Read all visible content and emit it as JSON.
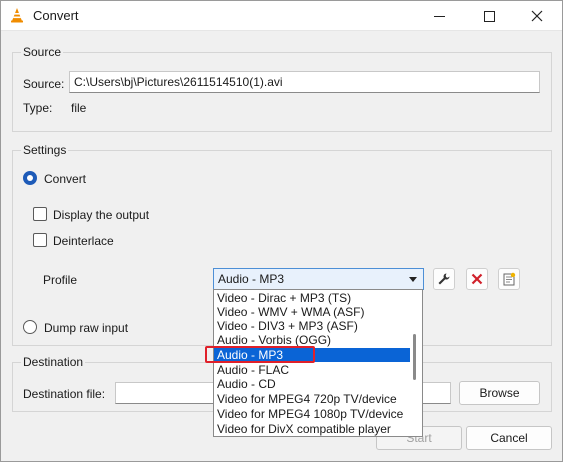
{
  "window": {
    "title": "Convert",
    "controls": {
      "minimize": "—",
      "maximize": "☐",
      "close": "✕"
    }
  },
  "source": {
    "group_label": "Source",
    "source_label": "Source:",
    "source_value": "C:\\Users\\bj\\Pictures\\2611514510(1).avi",
    "type_label": "Type:",
    "type_value": "file"
  },
  "settings": {
    "group_label": "Settings",
    "convert_label": "Convert",
    "convert_checked": true,
    "display_output_label": "Display the output",
    "deinterlace_label": "Deinterlace",
    "profile_label": "Profile",
    "profile_selected": "Audio - MP3",
    "dump_raw_label": "Dump raw input",
    "profile_options": [
      "Video - Dirac + MP3 (TS)",
      "Video - WMV + WMA (ASF)",
      "Video - DIV3 + MP3 (ASF)",
      "Audio - Vorbis (OGG)",
      "Audio - MP3",
      "Audio - FLAC",
      "Audio - CD",
      "Video for MPEG4 720p TV/device",
      "Video for MPEG4 1080p TV/device",
      "Video for DivX compatible player"
    ],
    "highlighted_index": 4
  },
  "destination": {
    "group_label": "Destination",
    "file_label": "Destination file:",
    "file_value": "",
    "browse_label": "Browse"
  },
  "footer": {
    "start_label": "Start",
    "cancel_label": "Cancel"
  },
  "colors": {
    "accent": "#0a64d6",
    "highlight_outline": "#e0202a",
    "vlc_orange": "#f08c00",
    "delete_red": "#d0202a"
  }
}
